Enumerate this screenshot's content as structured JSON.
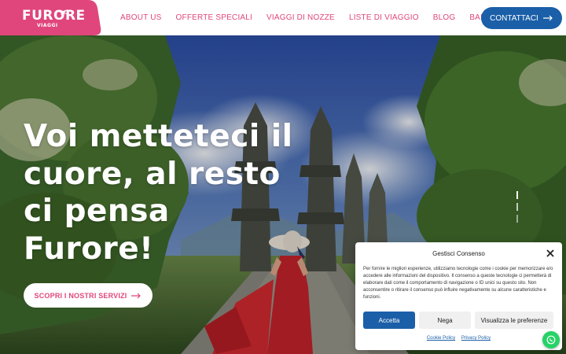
{
  "header": {
    "logo_text": "FURORE",
    "logo_sub": "VIAGGI",
    "nav": [
      "ABOUT US",
      "OFFERTE SPECIALI",
      "VIAGGI DI NOZZE",
      "LISTE DI VIAGGIO",
      "BLOG",
      "BAIA DI GUSTO"
    ],
    "contact_label": "CONTATTACI"
  },
  "hero": {
    "headline": [
      "Voi metteteci il",
      "cuore, al resto",
      "ci pensa",
      "Furore!"
    ],
    "cta_label": "SCOPRI I NOSTRI SERVIZI"
  },
  "cookie": {
    "title": "Gestisci Consenso",
    "body": "Per fornire le migliori esperienze, utilizziamo tecnologie come i cookie per memorizzare e/o accedere alle informazioni del dispositivo. Il consenso a queste tecnologie ci permetterà di elaborare dati come il comportamento di navigazione o ID unici su questo sito. Non acconsentire o ritirare il consenso può influire negativamente su alcune caratteristiche e funzioni.",
    "accept": "Accetta",
    "deny": "Nega",
    "prefs": "Visualizza le preferenze",
    "cookie_policy": "Cookie Policy",
    "privacy_policy": "Privacy Policy"
  },
  "colors": {
    "brand_pink": "#e0467c",
    "brand_blue": "#1a5fa8",
    "whatsapp_green": "#25d366"
  },
  "icons": [
    "plane-icon",
    "arrow-right-icon",
    "close-icon",
    "whatsapp-icon"
  ]
}
